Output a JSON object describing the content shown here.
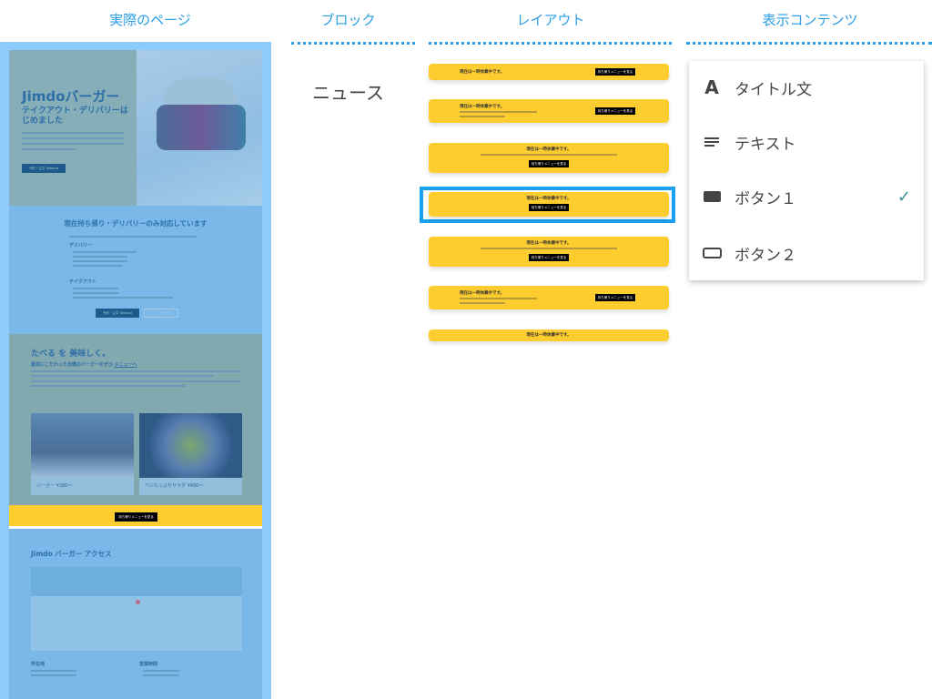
{
  "headers": {
    "actual_page": "実際のページ",
    "block": "ブロック",
    "layout": "レイアウト",
    "content": "表示コンテンツ"
  },
  "block_name": "ニュース",
  "page": {
    "hero_title": "Jimdoバーガー",
    "hero_subtitle": "テイクアウト・デリバリーはじめました",
    "hero_button": "予約・注文 Takeout",
    "notice_title": "現在持ち帰り・デリバリーのみ対応しています",
    "delivery": "デリバリー",
    "takeout": "テイクアウト",
    "notice_btn1": "予約・注文 Takeout",
    "notice_btn2": "メニューを見る",
    "concept_title": "たべる を 美味しく。",
    "concept_sub": "素材にこだわった自慢のバーガーをぜひ",
    "concept_link": "メニューへ",
    "card1": "バーガー ¥380〜",
    "card2": "ベジたっぷりサラダ ¥480〜",
    "news_button": "持ち帰りメニューを見る",
    "access_title": "Jimdo バーガー アクセス",
    "address_label": "所在地",
    "hours_label": "営業時間"
  },
  "layouts": {
    "title": "現在は一時休業中です。",
    "button": "持ち帰りメニューを見る",
    "selected_index": 3
  },
  "content_menu": [
    {
      "icon": "title-icon",
      "label": "タイトル文",
      "checked": false
    },
    {
      "icon": "text-icon",
      "label": "テキスト",
      "checked": false
    },
    {
      "icon": "filled-button-icon",
      "label": "ボタン１",
      "checked": true
    },
    {
      "icon": "outline-button-icon",
      "label": "ボタン２",
      "checked": false
    }
  ],
  "colors": {
    "accent": "#2a9ee6",
    "banner": "#fdcc2f",
    "check": "#3a8f9a"
  }
}
